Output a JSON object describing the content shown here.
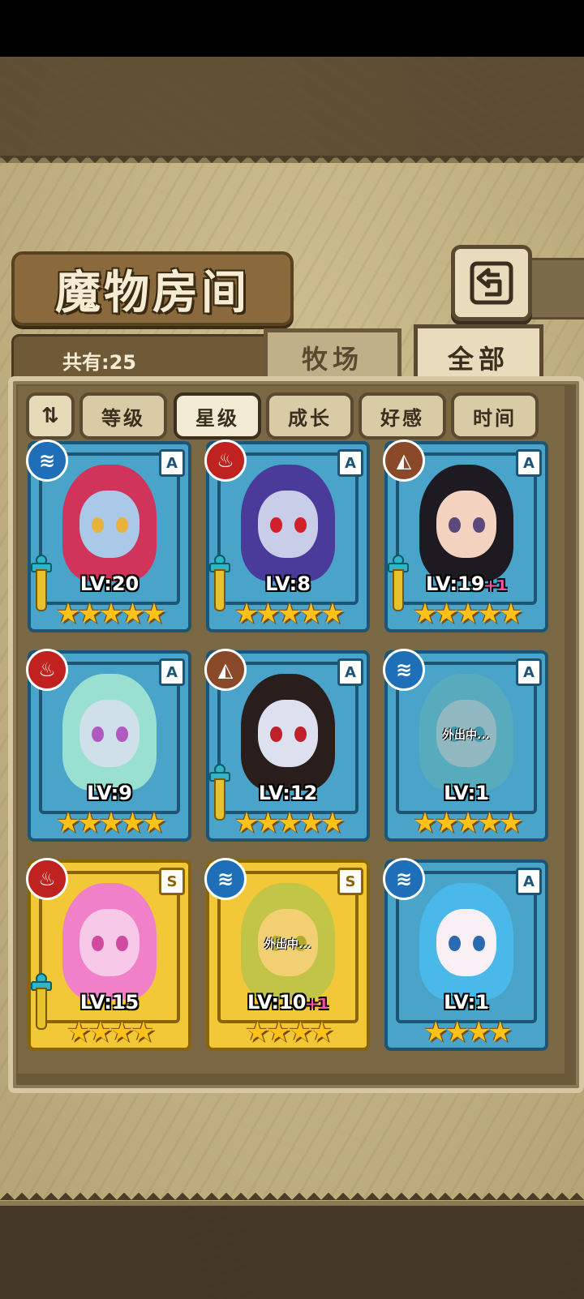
{
  "page_title": "魔物房间",
  "back_button_glyph": "⮌",
  "count_label": "共有:25",
  "tabs": {
    "ranch": "牧场",
    "all": "全部"
  },
  "sort": {
    "toggle_glyph": "⇅",
    "options": [
      "等级",
      "星级",
      "成长",
      "好感",
      "时间"
    ],
    "active": "星级"
  },
  "monsters": [
    {
      "element": "water",
      "element_icon": "water-icon",
      "rank": "A",
      "level": "LV:20",
      "bonus": "",
      "stars": "★★★★★",
      "frame": "blue",
      "status": "",
      "has_weapon": true,
      "hair": "#d0345a",
      "skin": "#aac8e8",
      "eyes": "#e8b23c"
    },
    {
      "element": "fire",
      "element_icon": "fire-icon",
      "rank": "A",
      "level": "LV:8",
      "bonus": "",
      "stars": "★★★★★",
      "frame": "blue",
      "status": "",
      "has_weapon": true,
      "hair": "#4a3a9a",
      "skin": "#c8cde8",
      "eyes": "#d0202a"
    },
    {
      "element": "earth",
      "element_icon": "earth-icon",
      "rank": "A",
      "level": "LV:19",
      "bonus": "+1",
      "stars": "★★★★★",
      "frame": "blue",
      "status": "",
      "has_weapon": true,
      "hair": "#1e1a22",
      "skin": "#f3d2c0",
      "eyes": "#5a4a7a"
    },
    {
      "element": "fire",
      "element_icon": "fire-icon",
      "rank": "A",
      "level": "LV:9",
      "bonus": "",
      "stars": "★★★★★",
      "frame": "blue",
      "status": "",
      "has_weapon": false,
      "hair": "#9ae0d0",
      "skin": "#cfe0ea",
      "eyes": "#b05ac0"
    },
    {
      "element": "earth",
      "element_icon": "earth-icon",
      "rank": "A",
      "level": "LV:12",
      "bonus": "",
      "stars": "★★★★★",
      "frame": "blue",
      "status": "",
      "has_weapon": true,
      "hair": "#2a1e1c",
      "skin": "#dde0ee",
      "eyes": "#c0202a"
    },
    {
      "element": "water",
      "element_icon": "water-icon",
      "rank": "A",
      "level": "LV:1",
      "bonus": "",
      "stars": "★★★★★",
      "frame": "blue",
      "status": "外出中...",
      "has_weapon": false,
      "hair": "#6ab5b0",
      "skin": "#e8d0b8",
      "eyes": "#3a8a8a"
    },
    {
      "element": "fire",
      "element_icon": "fire-icon",
      "rank": "S",
      "level": "LV:15",
      "bonus": "",
      "stars": "★★★★",
      "frame": "gold",
      "status": "",
      "has_weapon": true,
      "hair": "#f080c8",
      "skin": "#f8c8e8",
      "eyes": "#d04aa0"
    },
    {
      "element": "water",
      "element_icon": "water-icon",
      "rank": "S",
      "level": "LV:10",
      "bonus": "+1",
      "stars": "★★★★",
      "frame": "gold",
      "status": "外出中...",
      "has_weapon": false,
      "hair": "#8ac05a",
      "skin": "#f3d8b8",
      "eyes": "#6a8a2a"
    },
    {
      "element": "water",
      "element_icon": "water-icon",
      "rank": "A",
      "level": "LV:1",
      "bonus": "",
      "stars": "★★★★",
      "frame": "blue",
      "status": "",
      "has_weapon": false,
      "hair": "#4ab8e8",
      "skin": "#f8f0f4",
      "eyes": "#2a6ab0"
    }
  ],
  "colors": {
    "accent_blue": "#4aa3c9",
    "accent_gold": "#f2c838",
    "star": "#ffc21a",
    "bonus": "#ff4fa0"
  }
}
